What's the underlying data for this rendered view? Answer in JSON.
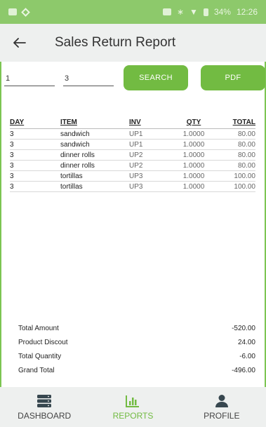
{
  "status_bar": {
    "battery": "34%",
    "time": "12:26"
  },
  "app_bar": {
    "title": "Sales Return Report"
  },
  "filters": {
    "from_value": "1",
    "to_value": "3",
    "search_label": "SEARCH",
    "pdf_label": "PDF"
  },
  "table": {
    "headers": {
      "day": "DAY",
      "item": "ITEM",
      "inv": "INV",
      "qty": "QTY",
      "total": "TOTAL"
    },
    "rows": [
      {
        "day": "3",
        "item": "sandwich",
        "inv": "UP1",
        "qty": "1.0000",
        "total": "80.00"
      },
      {
        "day": "3",
        "item": "sandwich",
        "inv": "UP1",
        "qty": "1.0000",
        "total": "80.00"
      },
      {
        "day": "3",
        "item": "dinner rolls",
        "inv": "UP2",
        "qty": "1.0000",
        "total": "80.00"
      },
      {
        "day": "3",
        "item": "dinner rolls",
        "inv": "UP2",
        "qty": "1.0000",
        "total": "80.00"
      },
      {
        "day": "3",
        "item": "tortillas",
        "inv": "UP3",
        "qty": "1.0000",
        "total": "100.00"
      },
      {
        "day": "3",
        "item": "tortillas",
        "inv": "UP3",
        "qty": "1.0000",
        "total": "100.00"
      }
    ]
  },
  "summary": {
    "total_amount_label": "Total Amount",
    "total_amount": "-520.00",
    "discount_label": "Product Discout",
    "discount": "24.00",
    "quantity_label": "Total Quantity",
    "quantity": "-6.00",
    "grand_total_label": "Grand Total",
    "grand_total": "-496.00"
  },
  "nav": {
    "dashboard": "DASHBOARD",
    "reports": "REPORTS",
    "profile": "PROFILE"
  },
  "colors": {
    "accent": "#72bb42",
    "status_bar": "#8dc96b",
    "app_bar": "#eef0ef"
  }
}
